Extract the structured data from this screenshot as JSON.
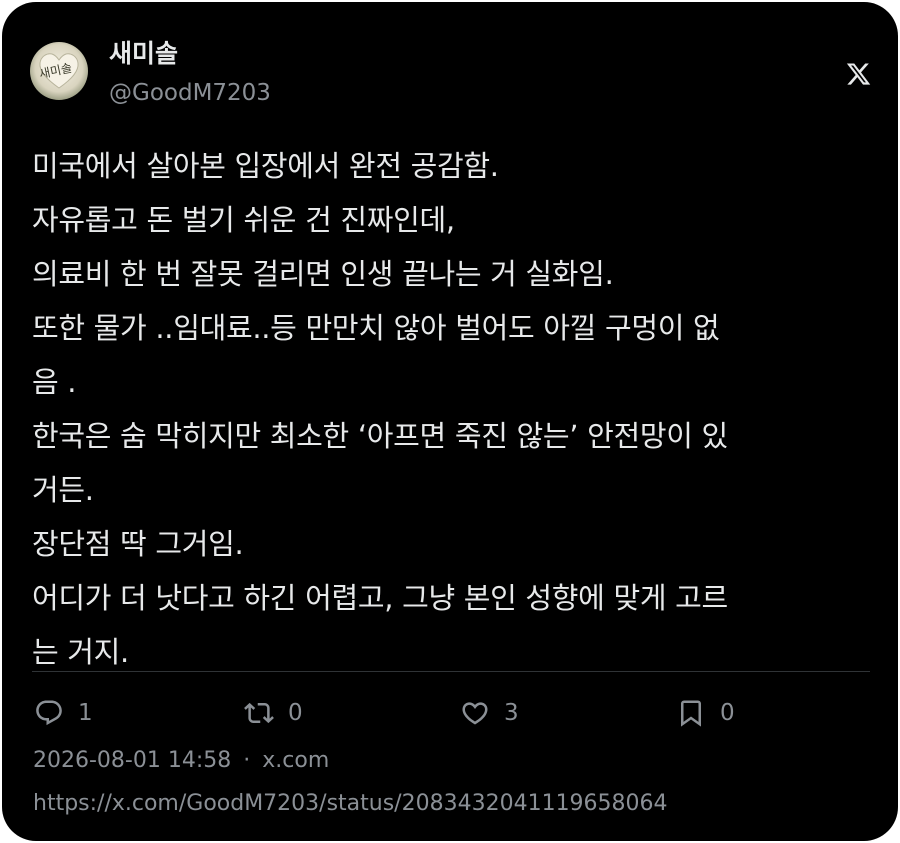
{
  "author": {
    "display_name": "새미솔",
    "handle": "@GoodM7203",
    "avatar_text": "새미솔"
  },
  "brand": {
    "logo": "x-logo-icon"
  },
  "tweet": {
    "text": "미국에서 살아본 입장에서 완전 공감함.\n자유롭고 돈 벌기 쉬운 건 진짜인데,\n의료비 한 번 잘못 걸리면 인생 끝나는 거 실화임.\n또한 물가 ..임대료..등 만만치 않아 벌어도 아낄 구멍이 없\n음 .\n한국은 숨 막히지만 최소한 ‘아프면 죽진 않는’ 안전망이 있\n거든.\n장단점 딱 그거임.\n어디가 더 낫다고 하긴 어렵고, 그냥 본인 성향에 맞게 고르\n는 거지."
  },
  "actions": {
    "reply": {
      "icon": "reply-icon",
      "count": "1"
    },
    "retweet": {
      "icon": "retweet-icon",
      "count": "0"
    },
    "like": {
      "icon": "heart-icon",
      "count": "3"
    },
    "bookmark": {
      "icon": "bookmark-icon",
      "count": "0"
    }
  },
  "meta": {
    "timestamp": "2026-08-01 14:58",
    "separator": "·",
    "source": "x.com"
  },
  "url": "https://x.com/GoodM7203/status/2083432041119658064",
  "colors": {
    "background": "#000000",
    "text": "#e7e9ea",
    "secondary": "#8b9096",
    "divider": "#2f3336"
  }
}
